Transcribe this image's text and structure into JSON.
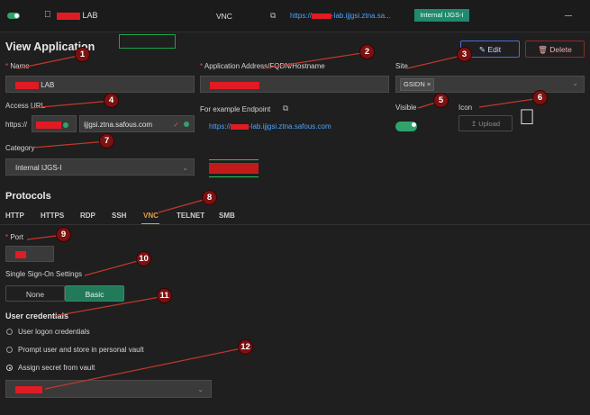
{
  "top_bar": {
    "app_name_suffix": "LAB",
    "protocol": "VNC",
    "url_prefix": "https://",
    "url_suffix": "-lab.ijjgsi.ztna.sa...",
    "category_tag": "Internal IJGS-I"
  },
  "page_title": "View Application",
  "actions": {
    "edit": "Edit",
    "delete": "Delete"
  },
  "fields": {
    "name": {
      "label": "Name",
      "value_suffix": "LAB"
    },
    "address": {
      "label": "Application Address/FQDN/Hostname"
    },
    "site": {
      "label": "Site",
      "tag": "GSIDN"
    },
    "access_url": {
      "label": "Access URL",
      "prefix": "https://",
      "domain": "ijjgsi.ztna.safous.com"
    },
    "example": {
      "label": "For example Endpoint",
      "url_prefix": "https://",
      "url_suffix": "-lab.ijjgsi.ztna.safous.com"
    },
    "visible": {
      "label": "Visible",
      "on": true
    },
    "icon": {
      "label": "Icon",
      "upload": "Upload"
    },
    "category": {
      "label": "Category",
      "value": "Internal IJGS-I"
    }
  },
  "protocols": {
    "title": "Protocols",
    "tabs": [
      "HTTP",
      "HTTPS",
      "RDP",
      "SSH",
      "VNC",
      "TELNET",
      "SMB"
    ],
    "active": "VNC"
  },
  "port": {
    "label": "Port"
  },
  "sso": {
    "label": "Single Sign-On Settings",
    "options": [
      "None",
      "Basic"
    ],
    "selected": "Basic"
  },
  "credentials": {
    "title": "User credentials",
    "options": [
      "User logon credentials",
      "Prompt user and store in personal vault",
      "Assign secret from vault"
    ],
    "selected": 2
  },
  "annotations": [
    "1",
    "2",
    "3",
    "4",
    "5",
    "6",
    "7",
    "8",
    "9",
    "10",
    "11",
    "12"
  ],
  "colors": {
    "accent": "#2fa36b",
    "link": "#4da3ff",
    "active_tab": "#e0a04a",
    "redaction": "#e01b24",
    "badge": "#7a1212",
    "annotation_line": "#c0392b"
  }
}
